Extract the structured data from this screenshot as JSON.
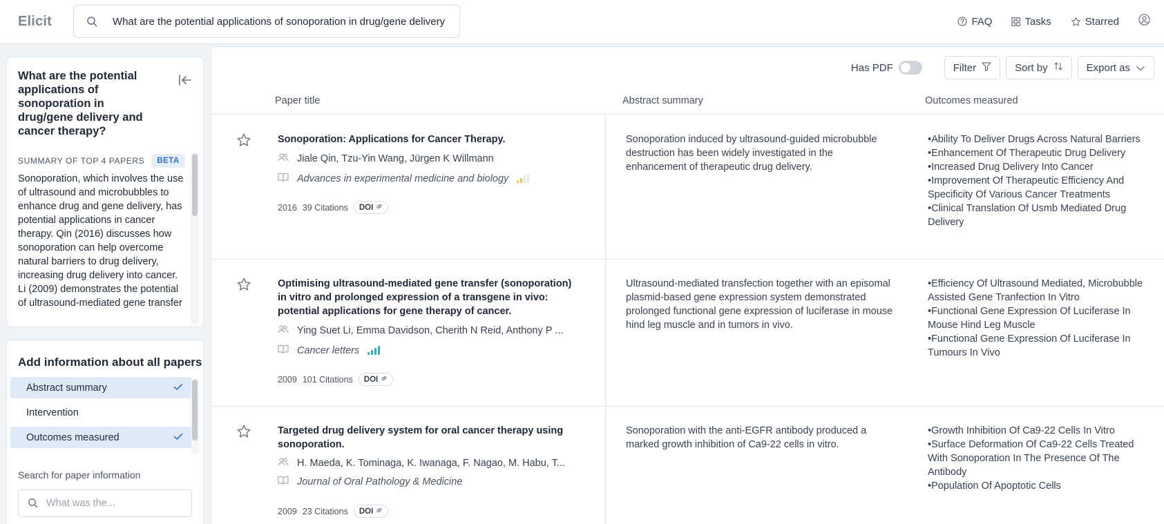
{
  "header": {
    "logo": "Elicit",
    "query": "What are the potential applications of sonoporation in drug/gene delivery",
    "nav": [
      {
        "label": "FAQ",
        "icon": "help-circle-icon"
      },
      {
        "label": "Tasks",
        "icon": "grid-icon"
      },
      {
        "label": "Starred",
        "icon": "star-outline-icon"
      }
    ]
  },
  "sidebar": {
    "question": "What are the potential applications of sonoporation in drug/gene delivery and cancer therapy?",
    "summary_title": "SUMMARY OF TOP 4 PAPERS",
    "beta": "BETA",
    "summary_text": "Sonoporation, which involves the use of ultrasound and microbubbles to enhance drug and gene delivery, has potential applications in cancer therapy. Qin (2016) discusses how sonoporation can help overcome natural barriers to drug delivery, increasing drug delivery into cancer. Li (2009) demonstrates the potential of ultrasound-mediated gene transfer",
    "add_info_title": "Add information about all papers",
    "columns": [
      {
        "label": "Abstract summary",
        "selected": true
      },
      {
        "label": "Intervention",
        "selected": false
      },
      {
        "label": "Outcomes measured",
        "selected": true
      }
    ],
    "search_label": "Search for paper information",
    "search_placeholder": "What was the..."
  },
  "toolbar": {
    "has_pdf": "Has PDF",
    "has_pdf_on": false,
    "filter": "Filter",
    "sort": "Sort by",
    "export": "Export as"
  },
  "table": {
    "headers": {
      "title": "Paper title",
      "abstract": "Abstract summary",
      "outcomes": "Outcomes measured"
    },
    "rows": [
      {
        "title": "Sonoporation: Applications for Cancer Therapy.",
        "authors": "Jiale Qin, Tzu-Yin Wang, Jürgen K Willmann",
        "journal": "Advances in experimental medicine and biology",
        "quality": "low",
        "year": "2016",
        "citations": "39 Citations",
        "doi": "DOI",
        "abstract": "Sonoporation induced by ultrasound-guided microbubble destruction has been widely investigated in the enhancement of therapeutic drug delivery.",
        "outcomes": [
          "•Ability To Deliver Drugs Across Natural Barriers",
          "•Enhancement Of Therapeutic Drug Delivery",
          "•Increased Drug Delivery Into Cancer",
          "•Improvement Of Therapeutic Efficiency And Specificity Of Various Cancer Treatments",
          "•Clinical Translation Of Usmb Mediated Drug Delivery"
        ]
      },
      {
        "title": "Optimising ultrasound-mediated gene transfer (sonoporation) in vitro and prolonged expression of a transgene in vivo: potential applications for gene therapy of cancer.",
        "authors": "Ying Suet Li, Emma Davidson, Cherith N Reid, Anthony P ...",
        "journal": "Cancer letters",
        "quality": "high",
        "year": "2009",
        "citations": "101 Citations",
        "doi": "DOI",
        "abstract": "Ultrasound-mediated transfection together with an episomal plasmid-based gene expression system demonstrated prolonged functional gene expression of luciferase in mouse hind leg muscle and in tumors in vivo.",
        "outcomes": [
          "•Efficiency Of Ultrasound Mediated, Microbubble Assisted Gene Tranfection In Vitro",
          "•Functional Gene Expression Of Luciferase In Mouse Hind Leg Muscle",
          "•Functional Gene Expression Of Luciferase In Tumours In Vivo"
        ]
      },
      {
        "title": "Targeted drug delivery system for oral cancer therapy using sonoporation.",
        "authors": "H. Maeda, K. Tominaga, K. Iwanaga, F. Nagao, M. Habu, T...",
        "journal": "Journal of Oral Pathology & Medicine",
        "quality": "none",
        "year": "2009",
        "citations": "23 Citations",
        "doi": "DOI",
        "abstract": "Sonoporation with the anti-EGFR antibody produced a marked growth inhibition of Ca9-22 cells in vitro.",
        "outcomes": [
          "•Growth Inhibition Of Ca9-22 Cells In Vitro",
          "•Surface Deformation Of Ca9-22 Cells Treated With Sonoporation In The Presence Of The Antibody",
          "•Population Of Apoptotic Cells"
        ]
      }
    ]
  },
  "colors": {
    "accent": "#2f6fd6",
    "selected_bg": "#dfe9f8",
    "bar_low": "#f2c14e",
    "bar_high": "#2bb3c0"
  }
}
